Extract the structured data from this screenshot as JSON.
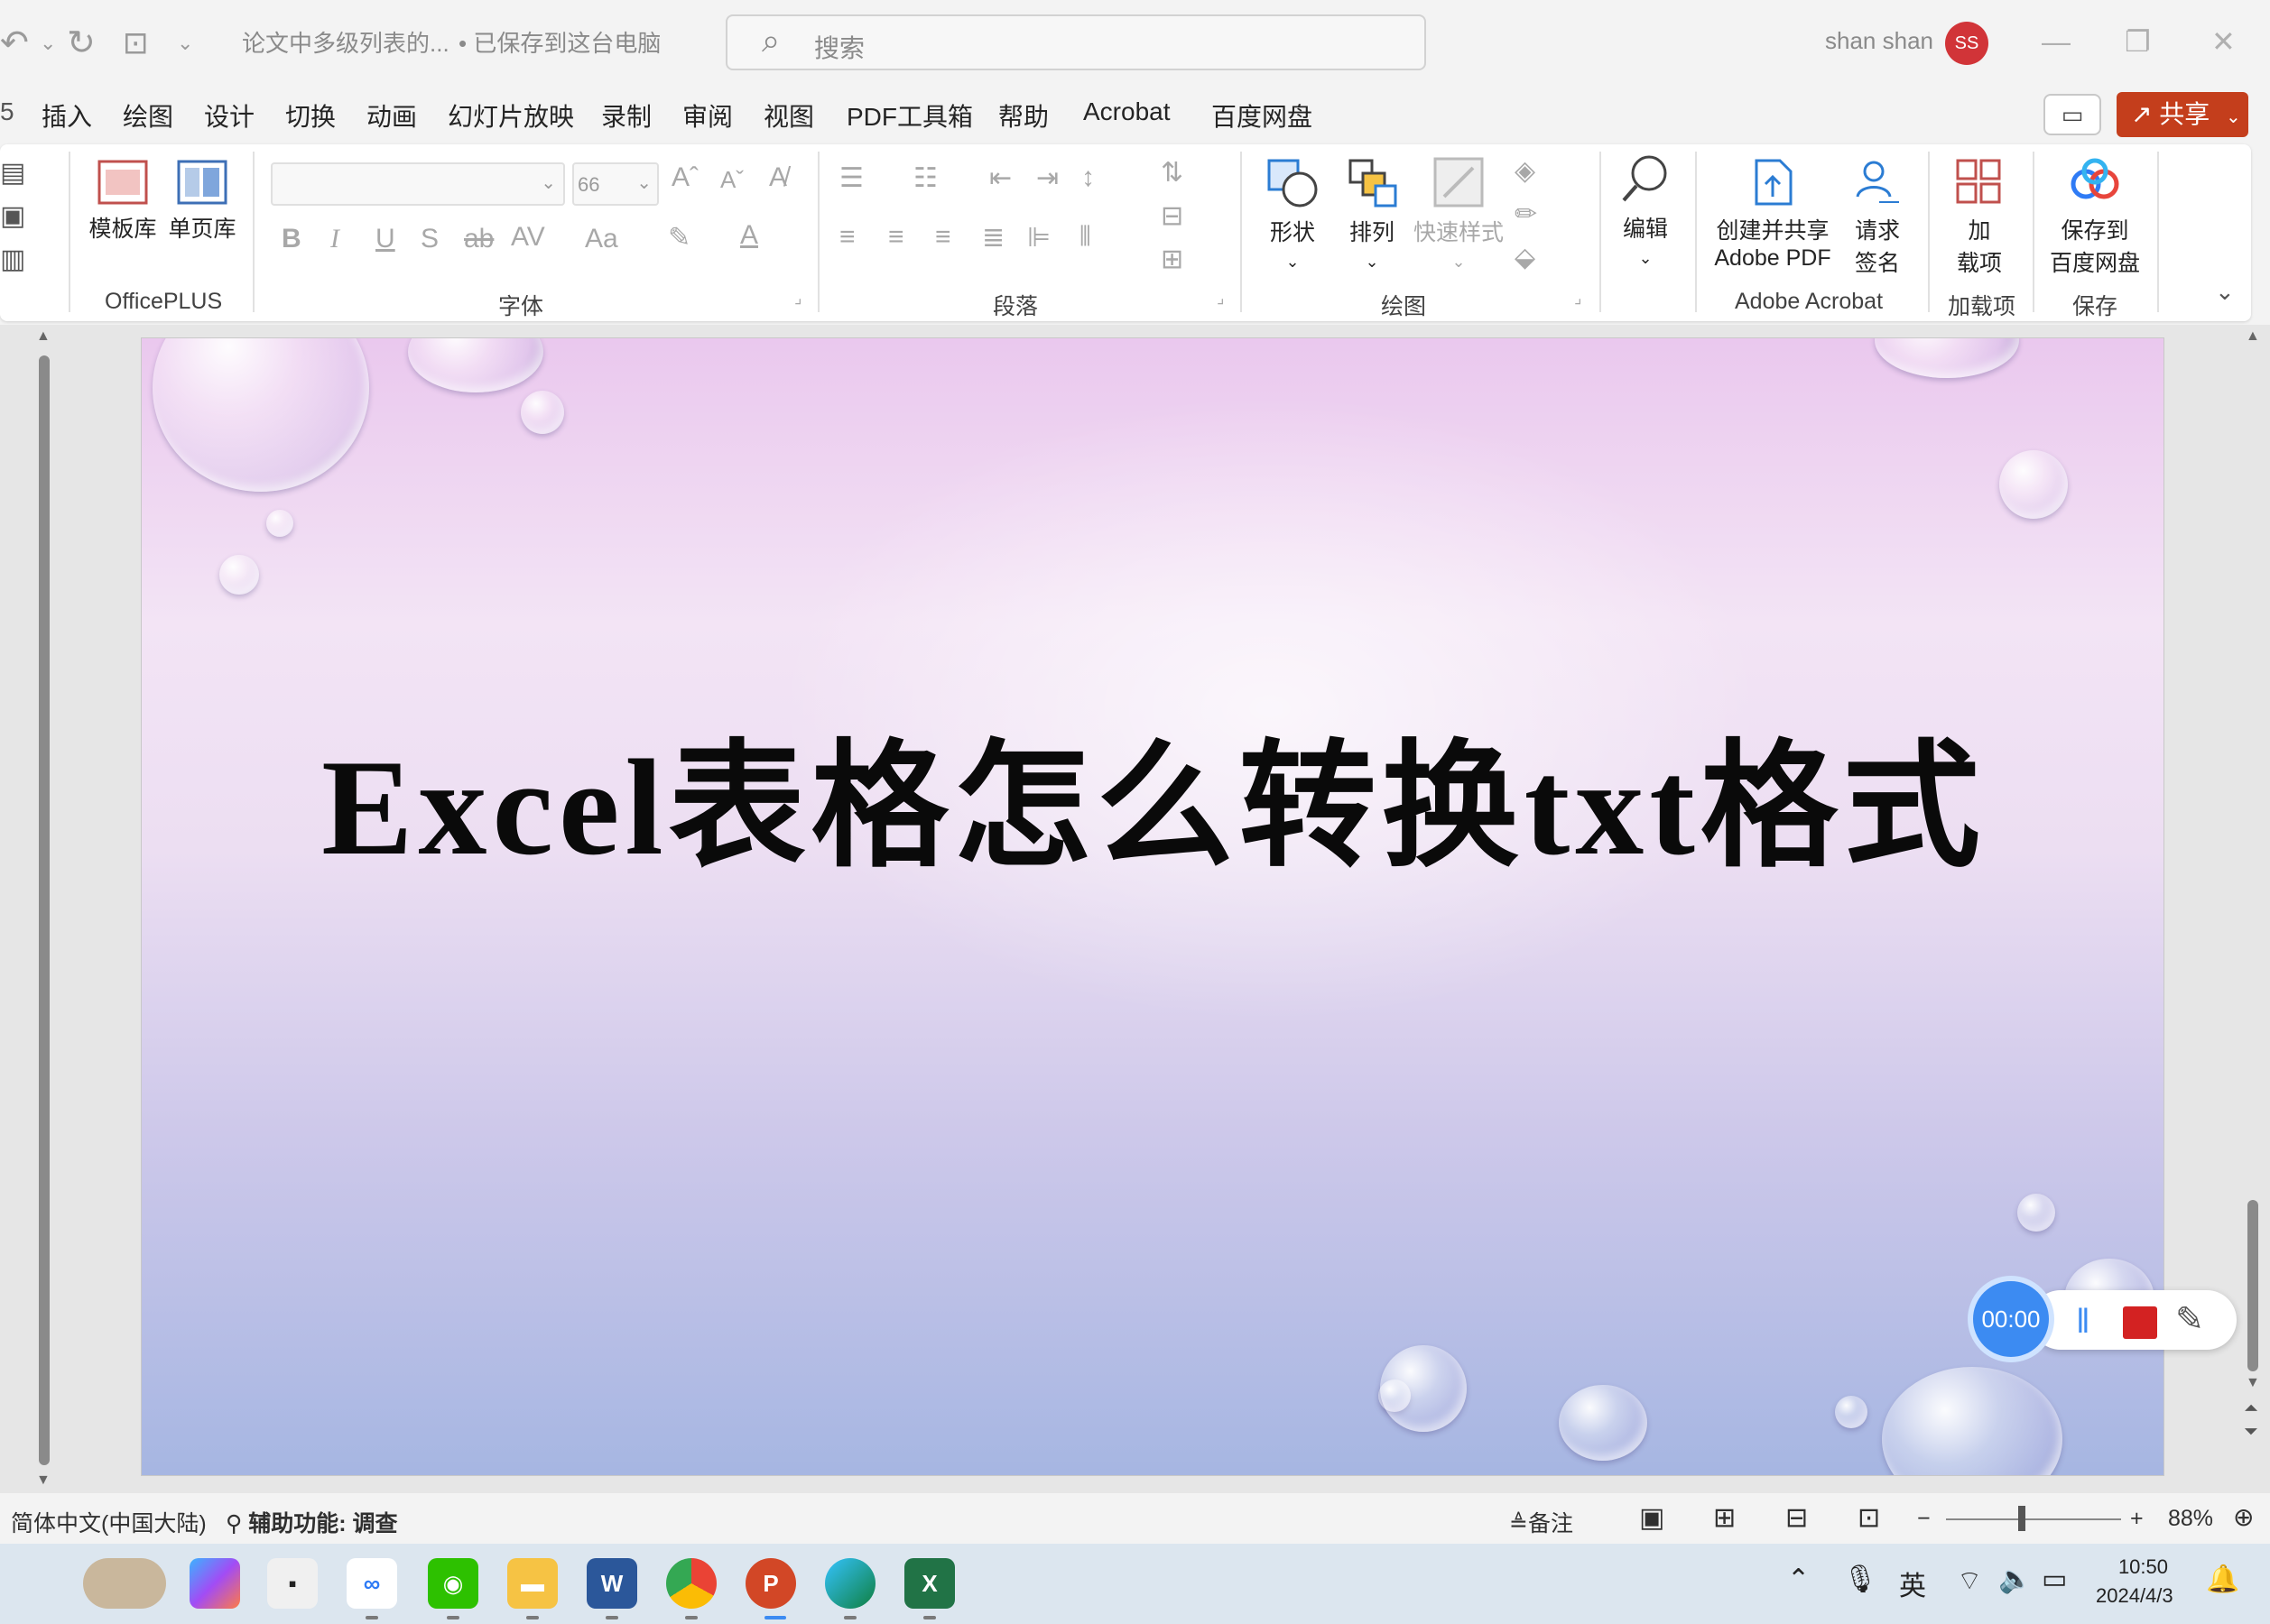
{
  "titlebar": {
    "doc_name": "论文中多级列表的...",
    "save_status": "• 已保存到这台电脑",
    "search_placeholder": "搜索",
    "user_name": "shan shan",
    "user_initials": "SS"
  },
  "menu": {
    "items": [
      "插入",
      "绘图",
      "设计",
      "切换",
      "动画",
      "幻灯片放映",
      "录制",
      "审阅",
      "视图",
      "PDF工具箱",
      "帮助",
      "Acrobat",
      "百度网盘"
    ],
    "share_label": "共享"
  },
  "ribbon": {
    "officeplus": {
      "label": "OfficePLUS",
      "template_lib": "模板库",
      "single_page_lib": "单页库"
    },
    "font": {
      "label": "字体",
      "size_value": "66",
      "bold": "B",
      "italic": "I",
      "underline": "U",
      "shadow": "S",
      "strike": "ab",
      "spacing": "AV",
      "case": "Aa",
      "grow": "A",
      "shrink": "A",
      "font_color": "A"
    },
    "paragraph": {
      "label": "段落"
    },
    "drawing": {
      "label": "绘图",
      "shapes": "形状",
      "arrange": "排列",
      "quick_styles": "快速样式"
    },
    "editing": {
      "label": "编辑"
    },
    "acrobat": {
      "label": "Adobe Acrobat",
      "create_share_1": "创建并共享",
      "create_share_2": "Adobe PDF",
      "request_sign_1": "请求",
      "request_sign_2": "签名"
    },
    "addins": {
      "label": "加载项",
      "addins_1": "加",
      "addins_2": "载项"
    },
    "save": {
      "label": "保存",
      "baidu_1": "保存到",
      "baidu_2": "百度网盘"
    }
  },
  "slide": {
    "title": "Excel表格怎么转换txt格式"
  },
  "recorder": {
    "timer": "00:00"
  },
  "statusbar": {
    "language": "简体中文(中国大陆)",
    "accessibility": "辅助功能: 调查",
    "notes": "备注",
    "zoom_minus": "−",
    "zoom_plus": "+",
    "zoom_percent": "88%",
    "zoom_level": 0.88
  },
  "taskbar": {
    "time": "10:50",
    "date": "2024/4/3",
    "ime": "英",
    "apps": [
      "photo",
      "copilot",
      "terminal",
      "baidu-netdisk",
      "wechat",
      "file-explorer",
      "word",
      "chrome",
      "powerpoint",
      "edge",
      "excel"
    ]
  },
  "colors": {
    "share_button": "#c43e1c",
    "recorder_timer": "#3c8bf2",
    "recorder_stop": "#d32222",
    "avatar": "#d13438"
  }
}
